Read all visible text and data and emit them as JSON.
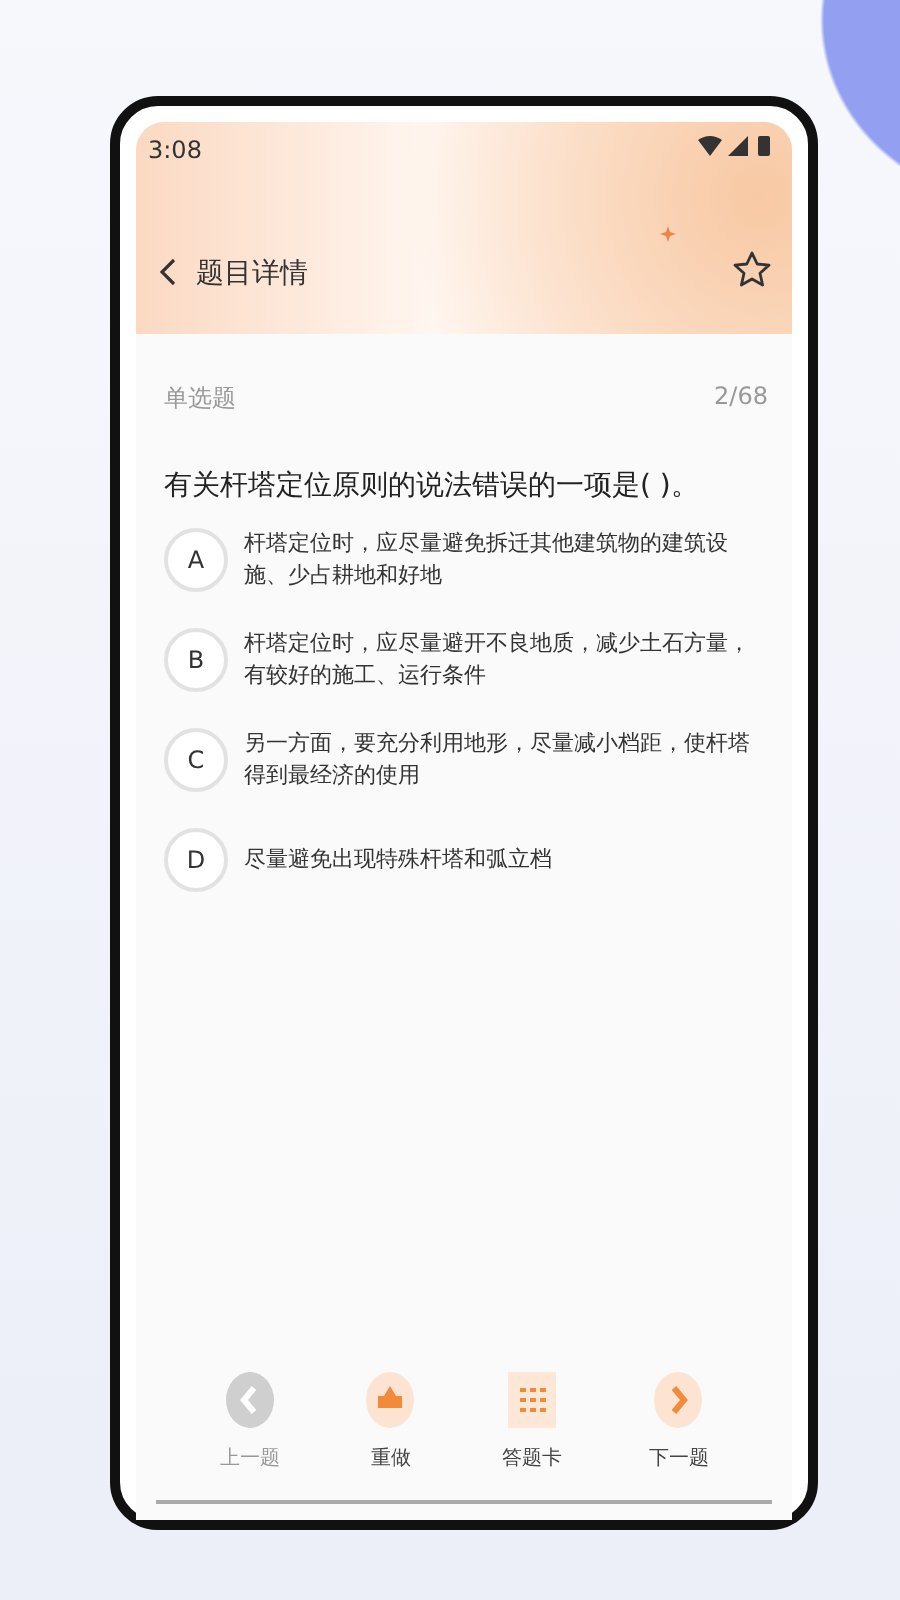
{
  "status_bar": {
    "time": "3:08"
  },
  "header": {
    "title": "题目详情"
  },
  "question": {
    "type": "单选题",
    "progress": "2/68",
    "text": "有关杆塔定位原则的说法错误的一项是(    )。",
    "options": [
      {
        "letter": "A",
        "text": "杆塔定位时，应尽量避免拆迁其他建筑物的建筑设施、少占耕地和好地",
        "selected": false
      },
      {
        "letter": "B",
        "text": "杆塔定位时，应尽量避开不良地质，减少土石方量，有较好的施工、运行条件",
        "selected": false
      },
      {
        "letter": "C",
        "text": "另一方面，要充分利用地形，尽量减小档距，使杆塔得到最经济的使用",
        "selected": false
      },
      {
        "letter": "D",
        "text": "尽量避免出现特殊杆塔和弧立档",
        "selected": false
      }
    ]
  },
  "toolbar": [
    {
      "kind": "prev",
      "label": "上一题",
      "disabled": true
    },
    {
      "kind": "redo",
      "label": "重做",
      "disabled": false
    },
    {
      "kind": "card",
      "label": "答题卡",
      "disabled": false
    },
    {
      "kind": "next",
      "label": "下一题",
      "disabled": false
    }
  ]
}
